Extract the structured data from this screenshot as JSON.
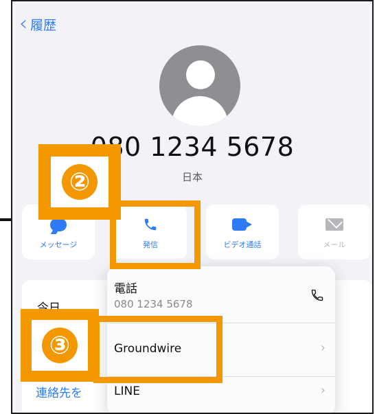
{
  "nav": {
    "back_label": "履歴"
  },
  "contact": {
    "number": "080 1234 5678",
    "country": "日本"
  },
  "actions": [
    {
      "label": "メッセージ",
      "icon": "message-icon",
      "enabled": true
    },
    {
      "label": "発信",
      "icon": "phone-icon",
      "enabled": true
    },
    {
      "label": "ビデオ通話",
      "icon": "video-icon",
      "enabled": true
    },
    {
      "label": "メール",
      "icon": "mail-icon",
      "enabled": false
    }
  ],
  "background": {
    "today_label": "今日",
    "contact_label": "連絡先を"
  },
  "call_menu": {
    "items": [
      {
        "title": "電話",
        "subtitle": "080 1234 5678",
        "icon": "phone-icon"
      },
      {
        "title": "Groundwire",
        "icon": "chevron-right-icon"
      },
      {
        "title": "LINE",
        "icon": "chevron-right-icon"
      }
    ]
  },
  "annotations": {
    "step2": "②",
    "step3": "③",
    "highlight_color": "#f39800"
  },
  "colors": {
    "accent": "#2f7bf6",
    "disabled": "#b6b6bb",
    "background": "#f2f2f7"
  }
}
